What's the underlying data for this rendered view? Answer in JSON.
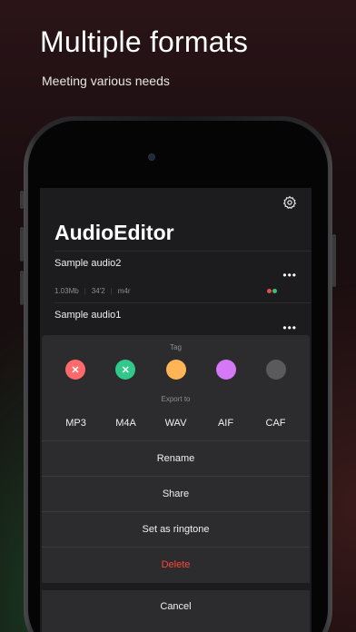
{
  "promo": {
    "headline": "Multiple formats",
    "subhead": "Meeting various needs"
  },
  "app": {
    "title": "AudioEditor",
    "settings_icon": "gear-icon"
  },
  "list": [
    {
      "title": "Sample audio2",
      "size": "1.03Mb",
      "duration": "34'2",
      "format": "m4r",
      "tag_colors": [
        "#e0524c",
        "#3dbf7a"
      ]
    },
    {
      "title": "Sample audio1"
    }
  ],
  "more_label": "•••",
  "sheet": {
    "tag_label": "Tag",
    "tags": [
      {
        "color": "#ff6b6b",
        "mark": "✕",
        "icon": "close-icon"
      },
      {
        "color": "#30c98a",
        "mark": "✕",
        "icon": "close-icon"
      },
      {
        "color": "#ffb455",
        "mark": ""
      },
      {
        "color": "#d478f5",
        "mark": ""
      },
      {
        "color": "#5a5a5c",
        "mark": ""
      }
    ],
    "export_label": "Export to",
    "formats": [
      "MP3",
      "M4A",
      "WAV",
      "AIF",
      "CAF"
    ],
    "actions": [
      "Rename",
      "Share",
      "Set as ringtone"
    ],
    "delete_label": "Delete",
    "cancel_label": "Cancel"
  },
  "colors": {
    "delete": "#ff453a",
    "background": "#1c1c1e"
  }
}
